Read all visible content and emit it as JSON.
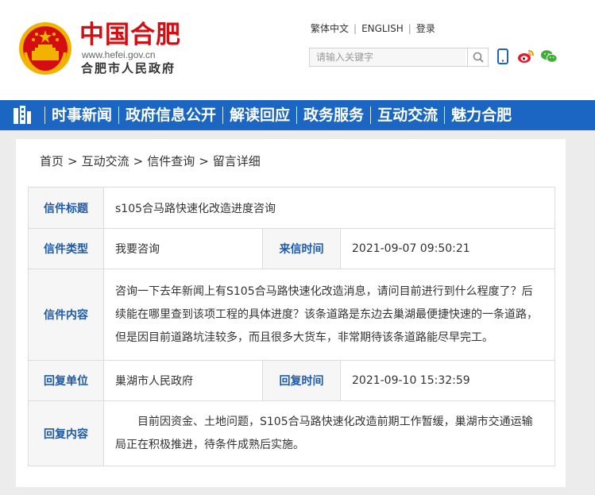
{
  "header": {
    "title": "中国合肥",
    "url": "www.hefei.gov.cn",
    "subtitle": "合肥市人民政府",
    "links": [
      "繁体中文",
      "ENGLISH",
      "登录"
    ],
    "search_placeholder": "请输入关键字",
    "icons": [
      "phone-icon",
      "weibo-icon",
      "wechat-icon",
      "search-icon"
    ]
  },
  "nav": {
    "items": [
      "时事新闻",
      "政府信息公开",
      "解读回应",
      "政务服务",
      "互动交流",
      "魅力合肥"
    ]
  },
  "breadcrumb": [
    "首页",
    "互动交流",
    "信件查询",
    "留言详细"
  ],
  "letter": {
    "title_label": "信件标题",
    "title": "s105合马路快速化改造进度咨询",
    "type_label": "信件类型",
    "type": "我要咨询",
    "time_label": "来信时间",
    "time": "2021-09-07 09:50:21",
    "content_label": "信件内容",
    "content": "咨询一下去年新闻上有S105合马路快速化改造消息，请问目前进行到什么程度了？后续能在哪里查到该项工程的具体进度？该条道路是东边去巢湖最便捷快速的一条道路，但是因目前道路坑洼较多，而且很多大货车，非常期待该条道路能尽早完工。",
    "reply_unit_label": "回复单位",
    "reply_unit": "巢湖市人民政府",
    "reply_time_label": "回复时间",
    "reply_time": "2021-09-10 15:32:59",
    "reply_content_label": "回复内容",
    "reply_content": "目前因资金、土地问题，S105合马路快速化改造前期工作暂缓，巢湖市交通运输局正在积极推进，待条件成熟后实施。"
  },
  "colors": {
    "nav_bg": "#1a66c2",
    "title_red": "#d40d12",
    "label_blue": "#1f5aa6"
  }
}
